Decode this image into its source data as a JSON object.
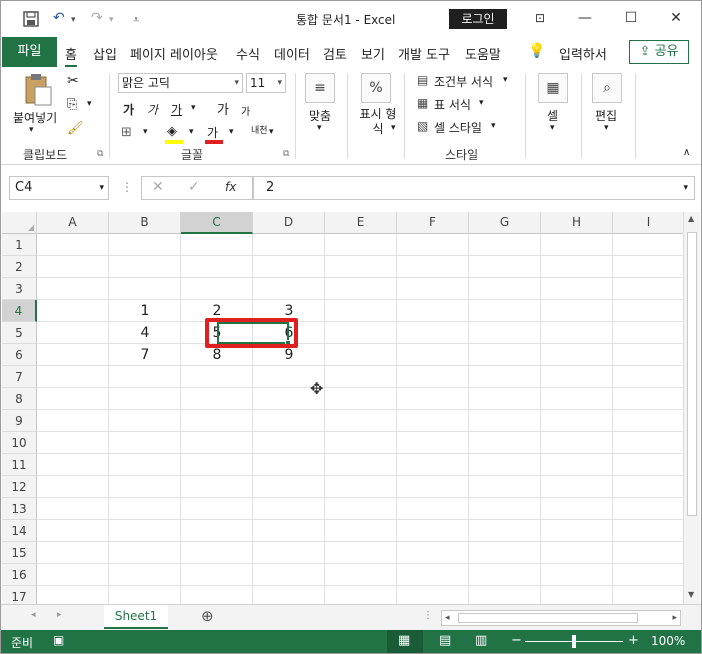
{
  "quick_access": {
    "save_icon": "save-icon",
    "undo_icon": "undo-icon",
    "redo_icon": "redo-icon"
  },
  "window": {
    "title": "통합 문서1  -  Excel",
    "login_label": "로그인"
  },
  "tabs": {
    "file": "파일",
    "items": [
      "홈",
      "삽입",
      "페이지 레이아웃",
      "수식",
      "데이터",
      "검토",
      "보기",
      "개발 도구",
      "도움말"
    ],
    "tell_me": "입력하서",
    "share": "공유"
  },
  "ribbon": {
    "paste_label": "붙여넣기",
    "clipboard_group": "클립보드",
    "font_name": "맑은 고딕",
    "font_size": "11",
    "font_group": "글꼴",
    "font_buttons": [
      "가",
      "가",
      "가",
      "가",
      "가"
    ],
    "hanja_label": "내천",
    "align_label": "맞춤",
    "number_label": "표시 형식",
    "number_symbol": "%",
    "style_items": [
      "조건부 서식",
      "표 서식",
      "셀 스타일"
    ],
    "style_group": "스타일",
    "cells_label": "셀",
    "edit_label": "편집"
  },
  "formula_bar": {
    "name_box": "C4",
    "fx_label": "fx",
    "value": "2"
  },
  "columns": [
    "A",
    "B",
    "C",
    "D",
    "E",
    "F",
    "G",
    "H",
    "I"
  ],
  "selected_column": "C",
  "rows": [
    "1",
    "2",
    "3",
    "4",
    "5",
    "6",
    "7",
    "8",
    "9",
    "10",
    "11",
    "12",
    "13",
    "14",
    "15",
    "16",
    "17"
  ],
  "selected_row": "4",
  "cells": {
    "B4": "1",
    "C4": "2",
    "D4": "3",
    "B5": "4",
    "C5": "5",
    "D5": "6",
    "B6": "7",
    "C6": "8",
    "D6": "9"
  },
  "sheet_tabs": [
    "Sheet1"
  ],
  "status": {
    "ready": "준비",
    "zoom": "100%"
  },
  "colors": {
    "accent": "#217346",
    "highlight_box": "#e02020"
  }
}
